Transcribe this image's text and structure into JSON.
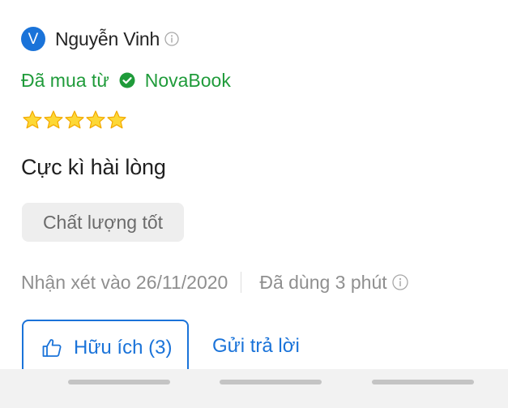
{
  "reviewer": {
    "avatar_initial": "V",
    "name": "Nguyễn Vinh",
    "info_icon": "info-circle-icon"
  },
  "purchase": {
    "prefix": "Đã mua từ",
    "seller": "NovaBook",
    "icon": "verified-check-icon"
  },
  "rating": {
    "stars": 5,
    "max": 5
  },
  "review": {
    "title": "Cực kì hài lòng",
    "attribute_tag": "Chất lượng tốt"
  },
  "meta": {
    "review_date": "Nhận xét vào 26/11/2020",
    "usage_time": "Đã dùng 3 phút"
  },
  "actions": {
    "helpful_label": "Hữu ích (3)",
    "reply_label": "Gửi trả lời"
  },
  "colors": {
    "brand_blue": "#1a73d9",
    "verified_green": "#1f9b3a",
    "star_yellow": "#fdd836",
    "star_outline": "#f2a900"
  }
}
